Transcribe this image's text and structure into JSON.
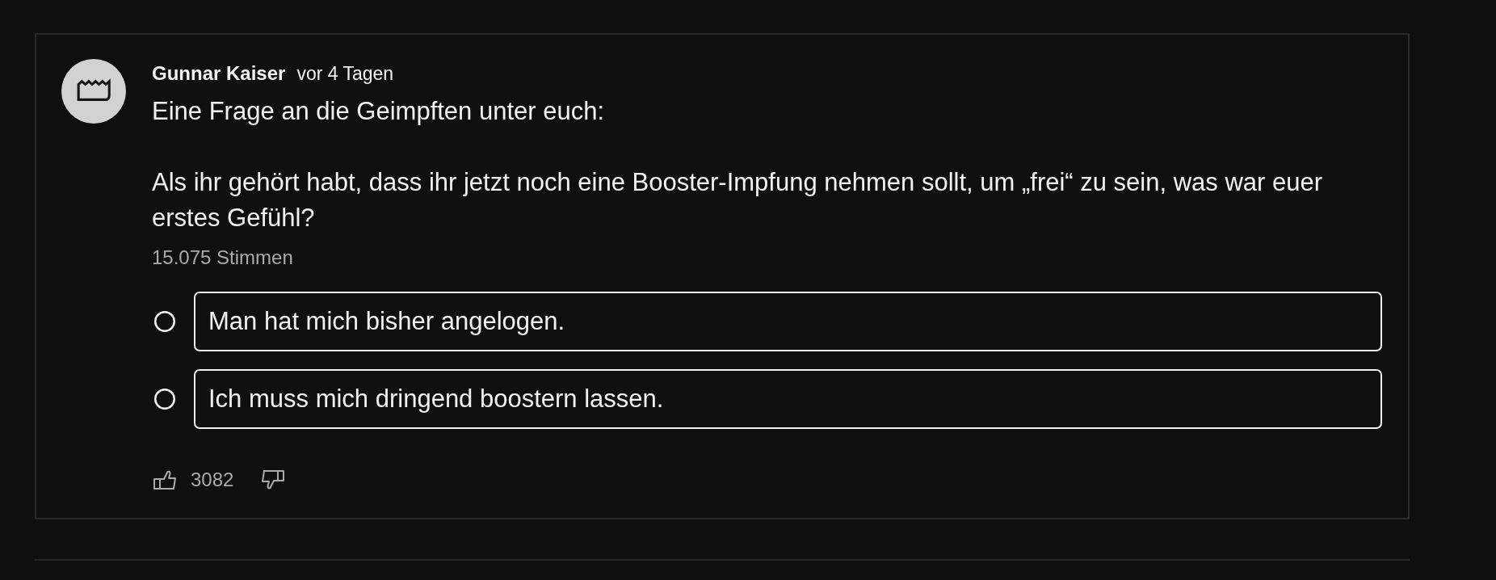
{
  "post": {
    "author": "Gunnar Kaiser",
    "time": "vor 4 Tagen",
    "paragraphs": [
      "Eine Frage an die Geimpften unter euch:",
      "Als ihr gehört habt, dass ihr jetzt noch eine Booster-Impfung nehmen sollt, um „frei“ zu sein, was war euer erstes Gefühl?"
    ],
    "votes": "15.075 Stimmen",
    "options": [
      {
        "label": "Man hat mich bisher angelogen.",
        "selected": false
      },
      {
        "label": "Ich muss mich dringend boostern lassen.",
        "selected": false
      }
    ],
    "likes": "3082"
  }
}
